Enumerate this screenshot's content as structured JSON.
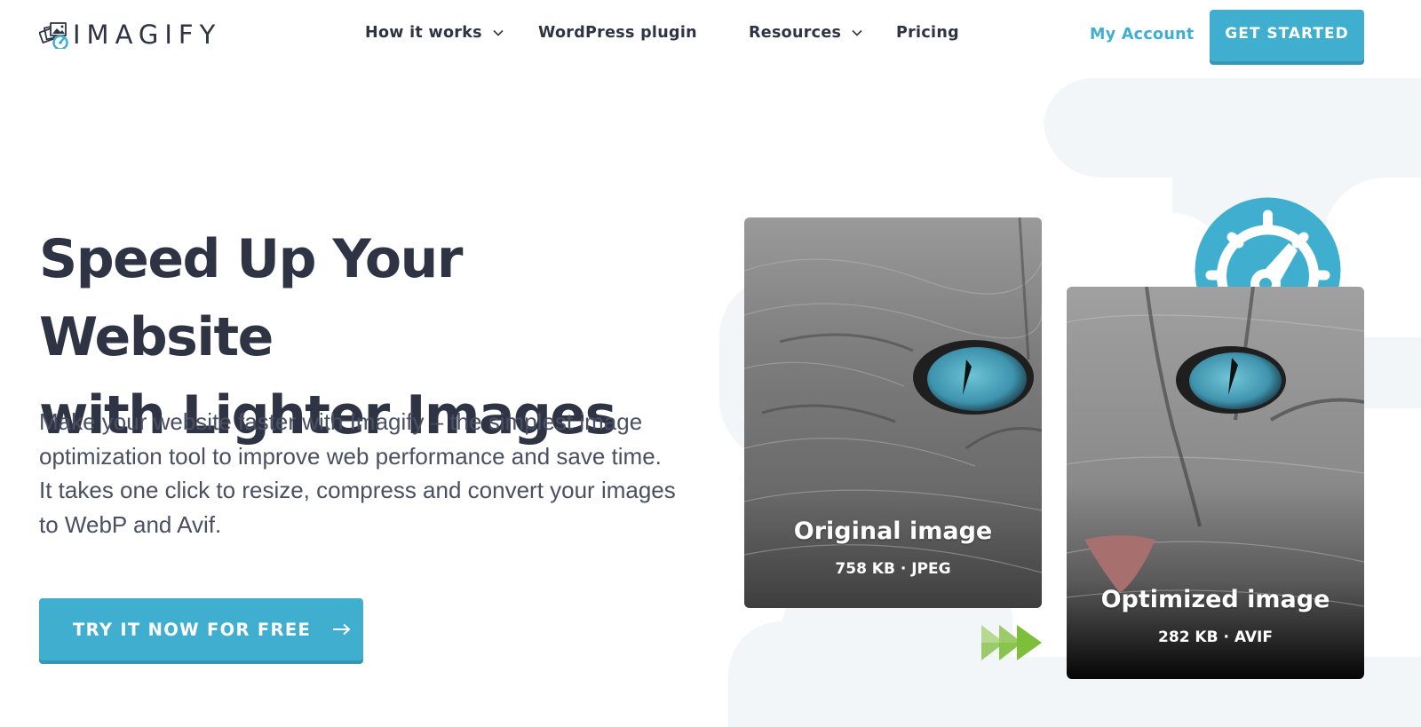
{
  "brand": {
    "name": "IMAGIFY",
    "logo_icon": "photo-stack-speed-icon",
    "accent_color": "#40afcf",
    "text_color": "#2f3444",
    "arrow_color": "#7dbf3a"
  },
  "nav": {
    "items": [
      {
        "label": "How it works",
        "has_dropdown": true
      },
      {
        "label": "WordPress plugin",
        "has_dropdown": false
      },
      {
        "label": "Resources",
        "has_dropdown": true
      },
      {
        "label": "Pricing",
        "has_dropdown": false
      }
    ],
    "my_account": "My Account",
    "get_started": "GET STARTED"
  },
  "hero": {
    "title_line1": "Speed Up Your Website",
    "title_line2": "with Lighter Images",
    "description": "Make your website faster with Imagify – the simplest image optimization tool to improve web performance and save time. It takes one click to resize, compress and convert your images to WebP and Avif.",
    "cta_label": "TRY IT NOW FOR FREE",
    "cta_icon": "arrow-right-icon"
  },
  "comparison": {
    "original": {
      "label": "Original image",
      "meta": "758 KB · JPEG"
    },
    "optimized": {
      "label": "Optimized image",
      "meta": "282 KB · AVIF"
    },
    "badge_icon": "speedometer-icon",
    "transition_icon": "fast-forward-arrows-icon"
  }
}
